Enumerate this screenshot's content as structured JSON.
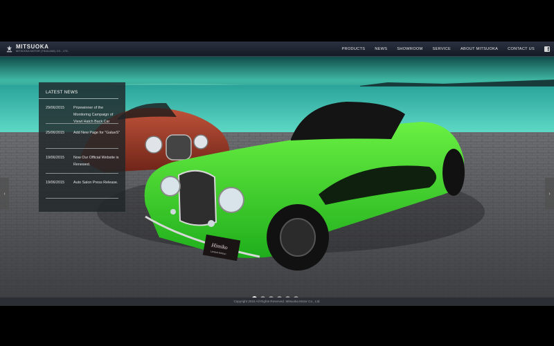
{
  "brand": {
    "name": "MITSUOKA",
    "subtitle": "MITSUOKA MOTOR (THAILAND) CO., LTD.",
    "logo_icon": "mitsuoka-emblem"
  },
  "nav": {
    "items": [
      "PRODUCTS",
      "NEWS",
      "SHOWROOM",
      "SERVICE",
      "ABOUT MITSUOKA",
      "CONTACT US"
    ],
    "social_icon": "facebook-icon"
  },
  "news": {
    "title": "LATEST NEWS",
    "items": [
      {
        "date": "29/06/2015",
        "text": "Prizewinner of the Monitoring Campaign of Viewt Hatch Back Car"
      },
      {
        "date": "25/06/2015",
        "text": "Add New Page for \"GalueS\""
      },
      {
        "date": "19/06/2015",
        "text": "Now Our Official Website is Renewed."
      },
      {
        "date": "19/06/2015",
        "text": "Auto Salon Press Release."
      }
    ]
  },
  "hero": {
    "plate_text": "Himiko",
    "plate_subtext": "Limited Edition"
  },
  "slider": {
    "prev_icon": "chevron-left-icon",
    "next_icon": "chevron-right-icon",
    "prev_glyph": "‹",
    "next_glyph": "›",
    "slide_count": 6,
    "active_index": 0
  },
  "footer": {
    "copyright": "Copyright 2015 All Rights Reserved. Mitsuoka Motor Co., Ltd."
  },
  "colors": {
    "accent_car": "#3fd62a",
    "header_bg": "#1d2330",
    "sea": "#2fb9a5"
  }
}
